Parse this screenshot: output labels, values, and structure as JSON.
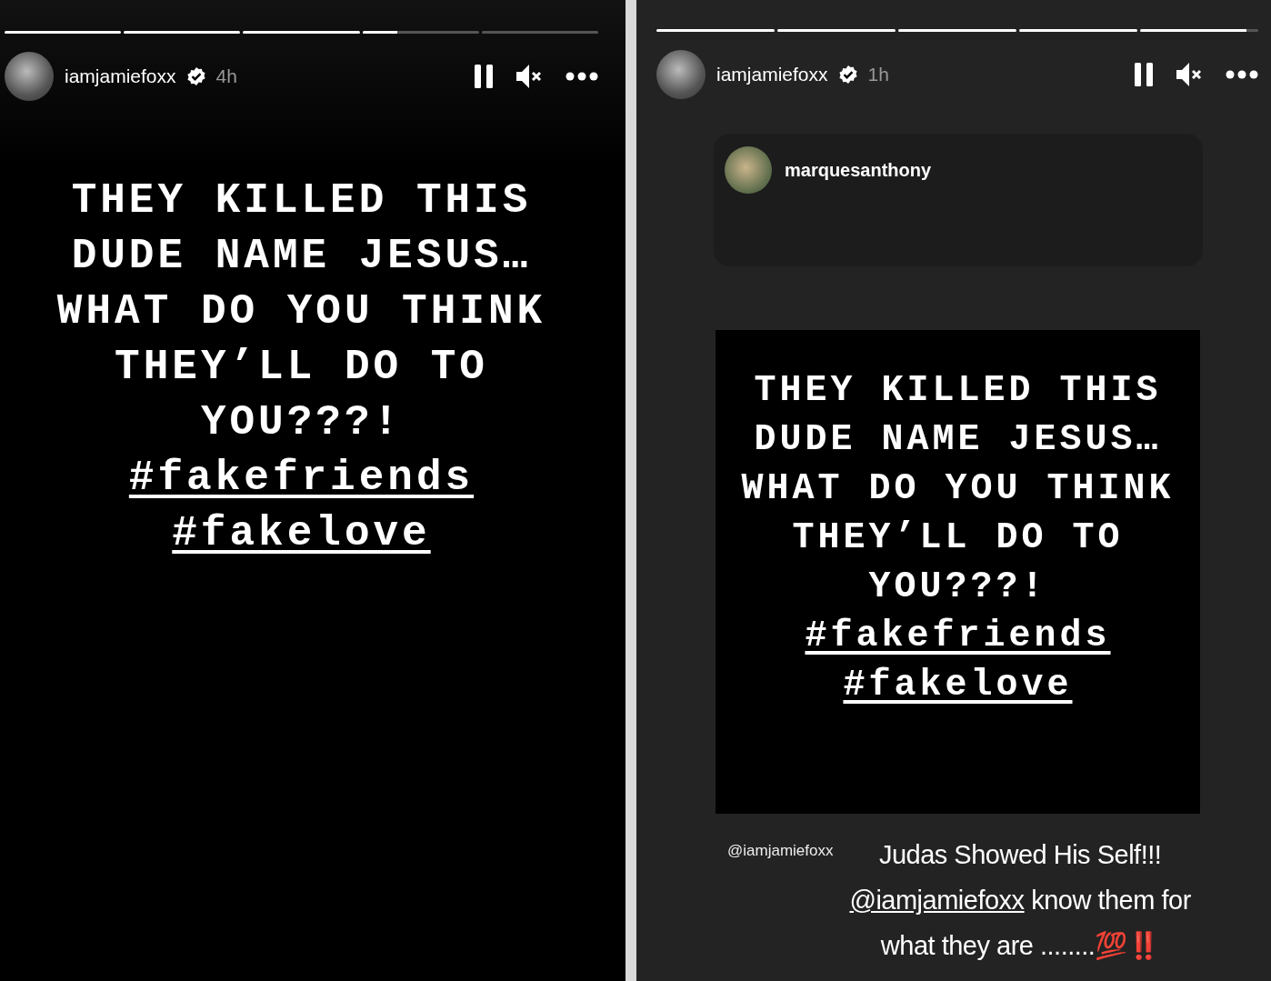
{
  "stories": [
    {
      "progress": [
        {
          "level": 1
        },
        {
          "level": 1
        },
        {
          "level": 1
        },
        {
          "level": 0.3
        },
        {
          "level": 0
        }
      ],
      "username": "iamjamiefoxx",
      "verified": true,
      "time": "4h",
      "text_lines": [
        {
          "kind": "plain",
          "text": "THEY KILLED THIS"
        },
        {
          "kind": "plain",
          "text": "DUDE NAME JESUS…"
        },
        {
          "kind": "plain",
          "text": "WHAT DO YOU THINK"
        },
        {
          "kind": "plain",
          "text": "THEY’LL DO TO"
        },
        {
          "kind": "plain",
          "text": "YOU???!"
        },
        {
          "kind": "hashtag",
          "text": "#fakefriends"
        },
        {
          "kind": "hashtag",
          "text": "#fakelove"
        }
      ]
    },
    {
      "progress": [
        {
          "level": 1
        },
        {
          "level": 1
        },
        {
          "level": 1
        },
        {
          "level": 1
        },
        {
          "level": 0.9
        }
      ],
      "username": "iamjamiefoxx",
      "verified": true,
      "time": "1h",
      "shared_post": {
        "username": "marquesanthony",
        "text_lines": [
          {
            "kind": "plain",
            "text": "THEY KILLED THIS"
          },
          {
            "kind": "plain",
            "text": "DUDE NAME JESUS…"
          },
          {
            "kind": "plain",
            "text": "WHAT DO YOU THINK"
          },
          {
            "kind": "plain",
            "text": "THEY’LL DO TO"
          },
          {
            "kind": "plain",
            "text": "YOU???!"
          },
          {
            "kind": "hashtag",
            "text": "#fakefriends"
          },
          {
            "kind": "hashtag",
            "text": "#fakelove"
          }
        ]
      },
      "mention_sticker": "@iamjamiefoxx",
      "caption_lines": [
        [
          {
            "kind": "text",
            "text": "Judas Showed His Self!!!"
          }
        ],
        [
          {
            "kind": "mention",
            "text": "@iamjamiefoxx"
          },
          {
            "kind": "text",
            "text": " know them for"
          }
        ],
        [
          {
            "kind": "text",
            "text": "what they are ........"
          },
          {
            "kind": "emoji",
            "text": "💯‼️"
          }
        ]
      ]
    }
  ]
}
